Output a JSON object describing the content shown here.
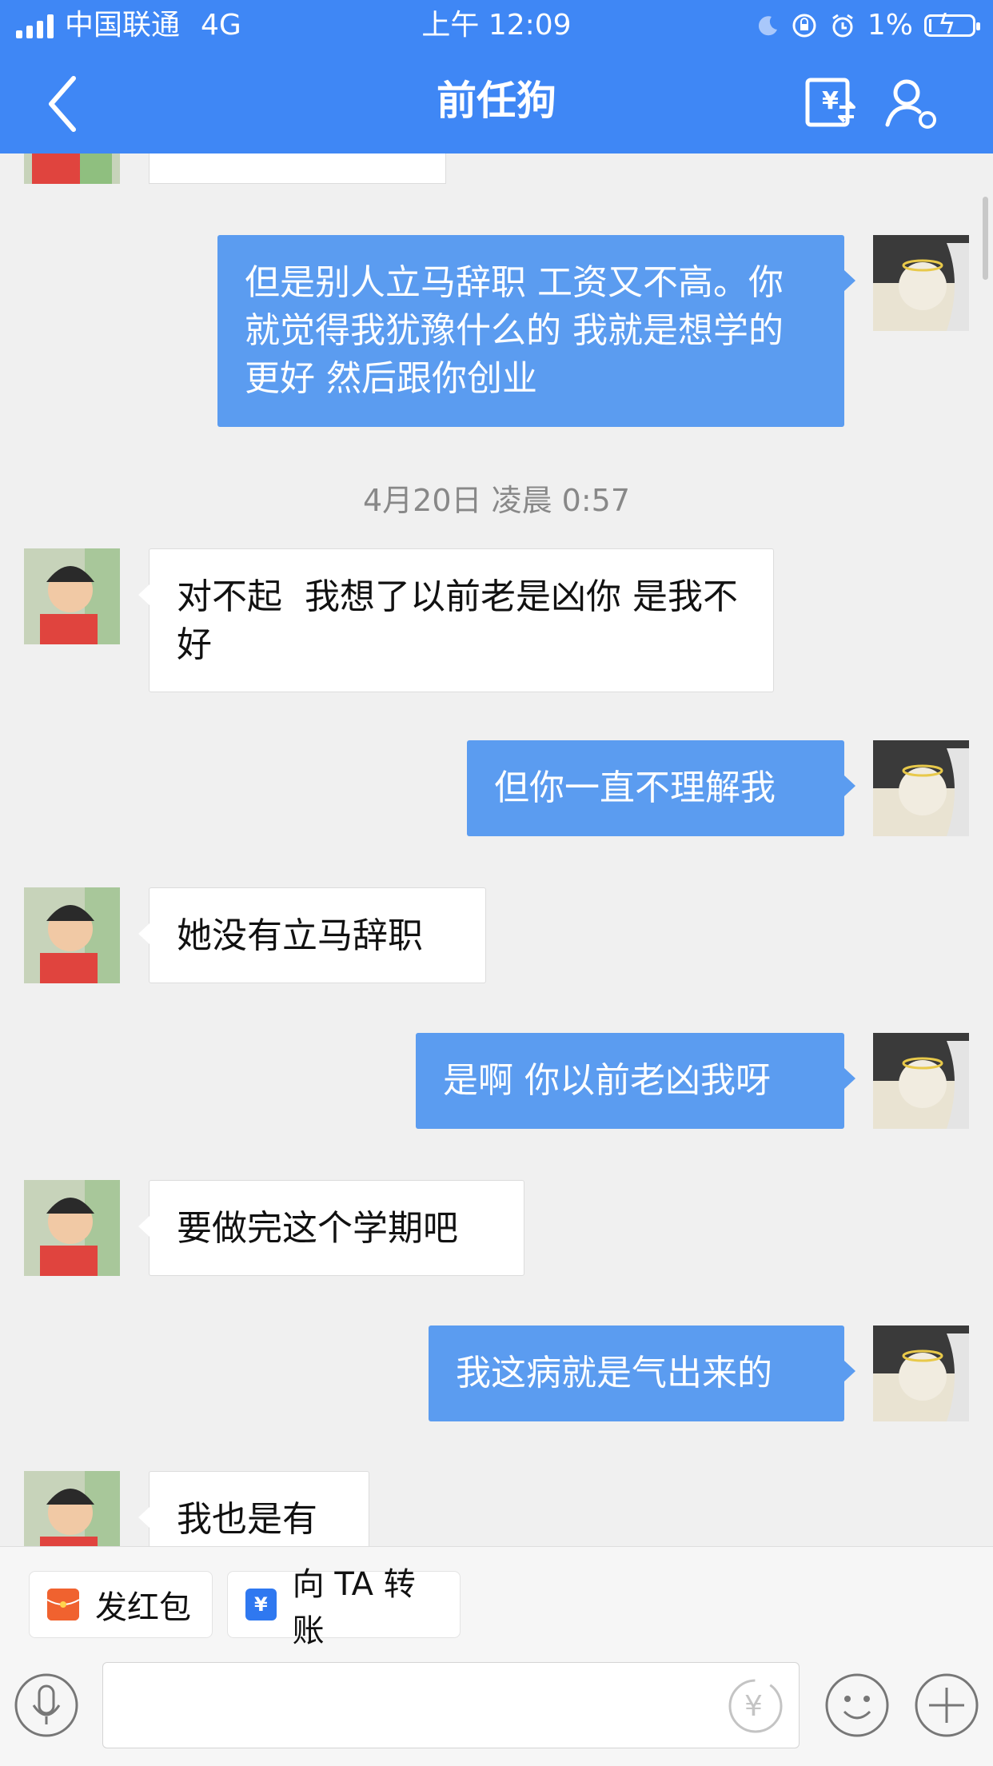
{
  "status_bar": {
    "carrier": "中国联通",
    "network": "4G",
    "time": "上午 12:09",
    "battery": "1%"
  },
  "header": {
    "title": "前任狗",
    "icons": [
      "back-icon",
      "transfer-record-icon",
      "contact-profile-icon"
    ]
  },
  "messages": [
    {
      "side": "right",
      "text": "但是别人立马辞职 工资又不高。你就觉得我犹豫什么的 我就是想学的更好 然后跟你创业"
    },
    {
      "side": "left",
      "text": "对不起  我想了以前老是凶你 是我不好"
    },
    {
      "side": "right",
      "text": "但你一直不理解我"
    },
    {
      "side": "left",
      "text": "她没有立马辞职"
    },
    {
      "side": "right",
      "text": "是啊 你以前老凶我呀"
    },
    {
      "side": "left",
      "text": "要做完这个学期吧"
    },
    {
      "side": "right",
      "text": "我这病就是气出来的"
    },
    {
      "side": "left",
      "text": "我也是有"
    }
  ],
  "timestamp": "4月20日 凌晨 0:57",
  "quick_actions": {
    "red_packet": "发红包",
    "transfer": "向 TA 转账"
  },
  "input": {
    "placeholder": "",
    "icons": [
      "voice-icon",
      "money-icon",
      "emoji-icon",
      "plus-icon"
    ]
  },
  "colors": {
    "header": "#3f87f5",
    "sent_bubble": "#5b9cf0",
    "received_bubble": "#ffffff",
    "background": "#f0f0f0"
  }
}
